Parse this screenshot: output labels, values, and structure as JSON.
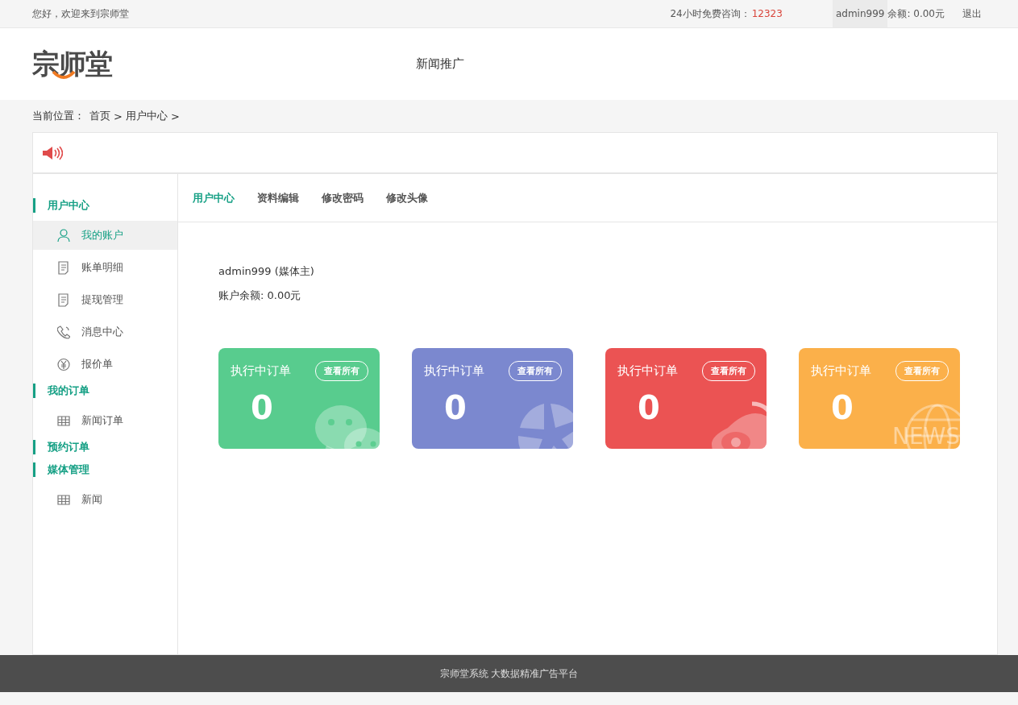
{
  "top_bar": {
    "welcome": "您好，欢迎来到宗师堂",
    "hotline_label": "24小时免费咨询：",
    "hotline": "12323",
    "user": "admin999",
    "balance": "余额: 0.00元",
    "logout": "退出"
  },
  "header": {
    "logo": "宗师堂",
    "nav": "新闻推广"
  },
  "breadcrumb": {
    "label": "当前位置：",
    "items": [
      "首页",
      ">",
      "用户中心",
      ">"
    ]
  },
  "sidebar": [
    {
      "label": "用户中心",
      "children": [
        {
          "label": "我的账户",
          "kind": "user",
          "selected": true
        },
        {
          "label": "账单明细",
          "kind": "doc",
          "selected": false
        },
        {
          "label": "提现管理",
          "kind": "doc",
          "selected": false
        },
        {
          "label": "消息中心",
          "kind": "phone",
          "selected": false
        },
        {
          "label": "报价单",
          "kind": "yen",
          "selected": false
        }
      ]
    },
    {
      "label": "我的订单",
      "children": [
        {
          "label": "新闻订单",
          "kind": "table",
          "selected": false
        }
      ]
    },
    {
      "label": "预约订单"
    },
    {
      "label": "媒体管理",
      "children": [
        {
          "label": "新闻",
          "kind": "table",
          "selected": false
        }
      ]
    }
  ],
  "tabs": [
    {
      "label": "用户中心",
      "selected": true
    },
    {
      "label": "资料编辑",
      "selected": false
    },
    {
      "label": "修改密码",
      "selected": false
    },
    {
      "label": "修改头像",
      "selected": false
    }
  ],
  "account": {
    "name": "admin999 (媒体主)",
    "balance": "账户余额: 0.00元"
  },
  "cards": [
    {
      "title": "执行中订单",
      "button": "查看所有",
      "count": "0",
      "color": "#58cc8e",
      "kind": "chat"
    },
    {
      "title": "执行中订单",
      "button": "查看所有",
      "count": "0",
      "color": "#7b88cf",
      "kind": "shutter"
    },
    {
      "title": "执行中订单",
      "button": "查看所有",
      "count": "0",
      "color": "#eb5353",
      "kind": "eye"
    },
    {
      "title": "执行中订单",
      "button": "查看所有",
      "count": "0",
      "color": "#fbb04a",
      "kind": "globe",
      "decor_text": "NEWS"
    }
  ],
  "footer": "宗师堂系统 大数据精准广告平台"
}
